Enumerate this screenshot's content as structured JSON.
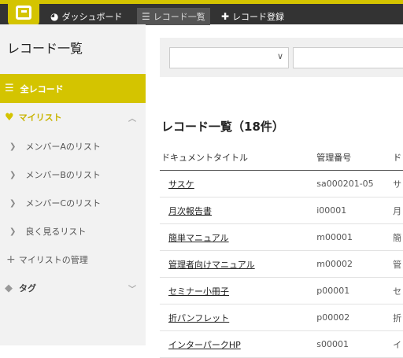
{
  "header": {
    "nav": {
      "dashboard": "ダッシュボード",
      "record_list": "レコード一覧",
      "record_new": "レコード登録"
    }
  },
  "sidebar": {
    "title": "レコード一覧",
    "all_records": "全レコード",
    "mylist": "マイリスト",
    "lists": [
      "メンバーAのリスト",
      "メンバーBのリスト",
      "メンバーCのリスト",
      "良く見るリスト"
    ],
    "manage": "マイリストの管理",
    "tag": "タグ"
  },
  "main": {
    "title": "レコード一覧（18件）",
    "columns": [
      "ドキュメントタイトル",
      "管理番号",
      "ド"
    ],
    "rows": [
      {
        "title": "サスケ",
        "id": "sa000201-05",
        "extra": "サ"
      },
      {
        "title": "月次報告書",
        "id": "i00001",
        "extra": "月"
      },
      {
        "title": "簡単マニュアル",
        "id": "m00001",
        "extra": "簡"
      },
      {
        "title": "管理者向けマニュアル",
        "id": "m00002",
        "extra": "管"
      },
      {
        "title": "セミナー小冊子",
        "id": "p00001",
        "extra": "セ"
      },
      {
        "title": "折パンフレット",
        "id": "p00002",
        "extra": "折"
      },
      {
        "title": "インターパークHP",
        "id": "s00001",
        "extra": "イ"
      }
    ]
  },
  "colors": {
    "accent": "#d4c400",
    "topbar": "#333333",
    "sidebar": "#f2f2f2"
  }
}
